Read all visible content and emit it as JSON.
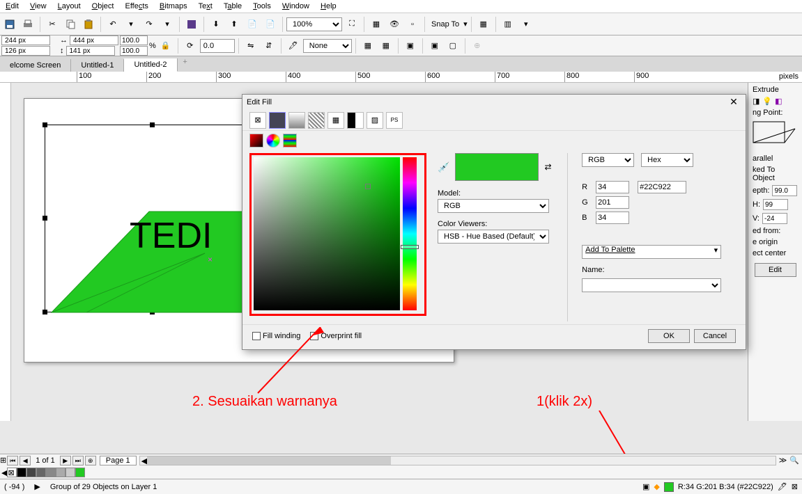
{
  "menu": {
    "items": [
      "Edit",
      "View",
      "Layout",
      "Object",
      "Effects",
      "Bitmaps",
      "Text",
      "Table",
      "Tools",
      "Window",
      "Help"
    ]
  },
  "toolbar1": {
    "zoom": "100%",
    "snap": "Snap To"
  },
  "properties": {
    "x": "244 px",
    "y": "126 px",
    "w": "444 px",
    "h": "141 px",
    "px": "100.0",
    "py": "100.0",
    "pct": "%",
    "rotate": "0.0",
    "outline": "None"
  },
  "tabs": [
    "elcome Screen",
    "Untitled-1",
    "Untitled-2"
  ],
  "ruler": {
    "marks": [
      100,
      200,
      300,
      400,
      500,
      600,
      700,
      800,
      900
    ],
    "unit": "pixels"
  },
  "canvas_text": "TEDI",
  "dialog": {
    "title": "Edit Fill",
    "model_label": "Model:",
    "model": "RGB",
    "viewers_label": "Color Viewers:",
    "viewers": "HSB - Hue Based (Default)",
    "space": "RGB",
    "format": "Hex",
    "r_label": "R",
    "r": "34",
    "g_label": "G",
    "g": "201",
    "b_label": "B",
    "b": "34",
    "hex": "#22C922",
    "palette": "Add To Palette",
    "name_label": "Name:",
    "fillwind": "Fill winding",
    "overprint": "Overprint fill",
    "ok": "OK",
    "cancel": "Cancel"
  },
  "extrude": {
    "title": "Extrude",
    "vp": "ng Point:",
    "parallel": "arallel",
    "locked": "ked To Object",
    "depth_l": "epth:",
    "depth": "99.0",
    "h_l": "H:",
    "h": "99",
    "v_l": "V:",
    "v": "-24",
    "from": "ed from:",
    "o1": "e origin",
    "o2": "ect center",
    "edit": "Edit"
  },
  "annotation1": "2. Sesuaikan warnanya",
  "annotation2": "1(klik 2x)",
  "pagenav": {
    "of": "1 of 1",
    "page": "Page 1"
  },
  "palette_colors": [
    "#fff",
    "#000",
    "#444",
    "#777",
    "#aaa",
    "#ccc",
    "#eee",
    "#22c922"
  ],
  "status": {
    "left_coord": "-94  )",
    "group": "Group of 29 Objects on Layer 1",
    "rgb": "R:34 G:201 B:34 (#22C922)"
  }
}
